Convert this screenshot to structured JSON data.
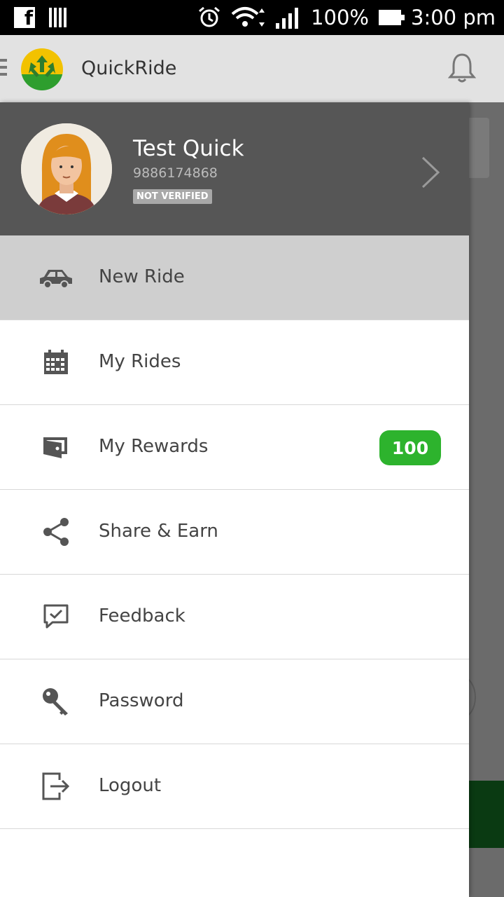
{
  "status_bar": {
    "battery": "100%",
    "time": "3:00 pm"
  },
  "app_bar": {
    "title": "QuickRide"
  },
  "profile": {
    "name": "Test Quick",
    "phone": "9886174868",
    "verification": "NOT VERIFIED"
  },
  "menu": [
    {
      "label": "New Ride",
      "icon": "car-icon",
      "active": true
    },
    {
      "label": "My Rides",
      "icon": "calendar-icon"
    },
    {
      "label": "My Rewards",
      "icon": "wallet-icon",
      "badge": "100"
    },
    {
      "label": "Share & Earn",
      "icon": "share-icon"
    },
    {
      "label": "Feedback",
      "icon": "feedback-icon"
    },
    {
      "label": "Password",
      "icon": "key-icon"
    },
    {
      "label": "Logout",
      "icon": "logout-icon"
    }
  ],
  "colors": {
    "badge_green": "#2db32d",
    "profile_bg": "#565656",
    "active_item_bg": "#cfcfcf"
  }
}
